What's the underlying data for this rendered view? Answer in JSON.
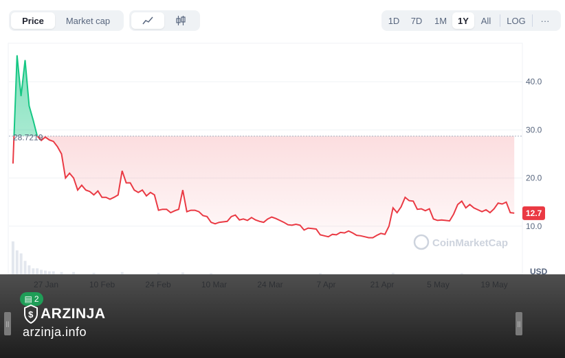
{
  "toolbar": {
    "metric_tabs": [
      {
        "label": "Price",
        "active": true
      },
      {
        "label": "Market cap",
        "active": false
      }
    ],
    "chart_type_icons": [
      {
        "icon": "line-chart-icon",
        "active": true
      },
      {
        "icon": "candlestick-icon",
        "active": false
      }
    ],
    "ranges": [
      {
        "label": "1D",
        "active": false
      },
      {
        "label": "7D",
        "active": false
      },
      {
        "label": "1M",
        "active": false
      },
      {
        "label": "1Y",
        "active": true
      },
      {
        "label": "All",
        "active": false
      }
    ],
    "log_label": "LOG",
    "more_label": "···"
  },
  "chart_data": {
    "type": "area",
    "currency_label": "USD",
    "reference_label": "28.7219",
    "reference_value": 28.7219,
    "current_label": "12.7",
    "current_value": 12.7,
    "y_ticks": [
      {
        "value": 10,
        "label": "10.0"
      },
      {
        "value": 20,
        "label": "20.0"
      },
      {
        "value": 30,
        "label": "30.0"
      },
      {
        "value": 40,
        "label": "40.0"
      }
    ],
    "x_ticks": [
      "27 Jan",
      "10 Feb",
      "24 Feb",
      "10 Mar",
      "24 Mar",
      "7 Apr",
      "21 Apr",
      "5 May",
      "19 May"
    ],
    "x_range": [
      "2025-01-20",
      "2025-05-27"
    ],
    "ylim": [
      0,
      48
    ],
    "series": [
      {
        "points": [
          [
            "2025-01-21",
            23
          ],
          [
            "2025-01-22",
            45.5
          ],
          [
            "2025-01-23",
            37
          ],
          [
            "2025-01-24",
            44.5
          ],
          [
            "2025-01-25",
            35
          ],
          [
            "2025-01-26",
            32
          ],
          [
            "2025-01-27",
            28.7
          ],
          [
            "2025-01-28",
            27.8
          ],
          [
            "2025-01-29",
            28.5
          ],
          [
            "2025-01-30",
            27.9
          ],
          [
            "2025-01-31",
            27.6
          ],
          [
            "2025-02-01",
            26.5
          ],
          [
            "2025-02-02",
            25
          ],
          [
            "2025-02-03",
            20
          ],
          [
            "2025-02-04",
            21
          ],
          [
            "2025-02-05",
            20
          ],
          [
            "2025-02-06",
            17.5
          ],
          [
            "2025-02-07",
            18.5
          ],
          [
            "2025-02-08",
            17.5
          ],
          [
            "2025-02-09",
            17.2
          ],
          [
            "2025-02-10",
            16.5
          ],
          [
            "2025-02-11",
            17.3
          ],
          [
            "2025-02-12",
            16
          ],
          [
            "2025-02-13",
            16
          ],
          [
            "2025-02-14",
            15.6
          ],
          [
            "2025-02-15",
            16
          ],
          [
            "2025-02-16",
            16.5
          ],
          [
            "2025-02-17",
            21.5
          ],
          [
            "2025-02-18",
            19
          ],
          [
            "2025-02-19",
            19
          ],
          [
            "2025-02-20",
            17.5
          ],
          [
            "2025-02-21",
            17
          ],
          [
            "2025-02-22",
            17.5
          ],
          [
            "2025-02-23",
            16.3
          ],
          [
            "2025-02-24",
            17
          ],
          [
            "2025-02-25",
            16.5
          ],
          [
            "2025-02-26",
            13.3
          ],
          [
            "2025-02-27",
            13.5
          ],
          [
            "2025-02-28",
            13.5
          ],
          [
            "2025-03-01",
            12.8
          ],
          [
            "2025-03-02",
            13.2
          ],
          [
            "2025-03-03",
            13.5
          ],
          [
            "2025-03-04",
            17.5
          ],
          [
            "2025-03-05",
            13
          ],
          [
            "2025-03-06",
            13.3
          ],
          [
            "2025-03-07",
            13.3
          ],
          [
            "2025-03-08",
            13
          ],
          [
            "2025-03-09",
            12.2
          ],
          [
            "2025-03-10",
            12
          ],
          [
            "2025-03-11",
            10.8
          ],
          [
            "2025-03-12",
            10.5
          ],
          [
            "2025-03-13",
            10.8
          ],
          [
            "2025-03-14",
            10.9
          ],
          [
            "2025-03-15",
            11
          ],
          [
            "2025-03-16",
            12
          ],
          [
            "2025-03-17",
            12.3
          ],
          [
            "2025-03-18",
            11.3
          ],
          [
            "2025-03-19",
            11.5
          ],
          [
            "2025-03-20",
            11.2
          ],
          [
            "2025-03-21",
            11.8
          ],
          [
            "2025-03-22",
            11.3
          ],
          [
            "2025-03-23",
            11
          ],
          [
            "2025-03-24",
            10.8
          ],
          [
            "2025-03-25",
            11.5
          ],
          [
            "2025-03-26",
            11.9
          ],
          [
            "2025-03-27",
            11.6
          ],
          [
            "2025-03-28",
            11.2
          ],
          [
            "2025-03-29",
            10.8
          ],
          [
            "2025-03-30",
            10.3
          ],
          [
            "2025-03-31",
            10.2
          ],
          [
            "2025-04-01",
            10.4
          ],
          [
            "2025-04-02",
            10.2
          ],
          [
            "2025-04-03",
            9.2
          ],
          [
            "2025-04-04",
            9.6
          ],
          [
            "2025-04-05",
            9.5
          ],
          [
            "2025-04-06",
            9.4
          ],
          [
            "2025-04-07",
            8.2
          ],
          [
            "2025-04-08",
            8
          ],
          [
            "2025-04-09",
            7.8
          ],
          [
            "2025-04-10",
            8.3
          ],
          [
            "2025-04-11",
            8.2
          ],
          [
            "2025-04-12",
            8.7
          ],
          [
            "2025-04-13",
            8.6
          ],
          [
            "2025-04-14",
            9
          ],
          [
            "2025-04-15",
            8.6
          ],
          [
            "2025-04-16",
            8.1
          ],
          [
            "2025-04-17",
            8
          ],
          [
            "2025-04-18",
            7.8
          ],
          [
            "2025-04-19",
            7.6
          ],
          [
            "2025-04-20",
            7.6
          ],
          [
            "2025-04-21",
            8.1
          ],
          [
            "2025-04-22",
            8.5
          ],
          [
            "2025-04-23",
            8.3
          ],
          [
            "2025-04-24",
            10
          ],
          [
            "2025-04-25",
            13.8
          ],
          [
            "2025-04-26",
            12.8
          ],
          [
            "2025-04-27",
            14
          ],
          [
            "2025-04-28",
            16
          ],
          [
            "2025-04-29",
            15.3
          ],
          [
            "2025-04-30",
            15.2
          ],
          [
            "2025-05-01",
            13.5
          ],
          [
            "2025-05-02",
            13.6
          ],
          [
            "2025-05-03",
            13.2
          ],
          [
            "2025-05-04",
            13.6
          ],
          [
            "2025-05-05",
            11.5
          ],
          [
            "2025-05-06",
            11.2
          ],
          [
            "2025-05-07",
            11.3
          ],
          [
            "2025-05-08",
            11.2
          ],
          [
            "2025-05-09",
            11.1
          ],
          [
            "2025-05-10",
            12.5
          ],
          [
            "2025-05-11",
            14.5
          ],
          [
            "2025-05-12",
            15.2
          ],
          [
            "2025-05-13",
            13.8
          ],
          [
            "2025-05-14",
            14.5
          ],
          [
            "2025-05-15",
            13.8
          ],
          [
            "2025-05-16",
            13.4
          ],
          [
            "2025-05-17",
            13
          ],
          [
            "2025-05-18",
            13.4
          ],
          [
            "2025-05-19",
            12.8
          ],
          [
            "2025-05-20",
            13.6
          ],
          [
            "2025-05-21",
            14.8
          ],
          [
            "2025-05-22",
            14.6
          ],
          [
            "2025-05-23",
            15
          ],
          [
            "2025-05-24",
            12.8
          ],
          [
            "2025-05-25",
            12.7
          ]
        ]
      }
    ],
    "volume": [
      [
        "2025-01-21",
        22
      ],
      [
        "2025-01-22",
        16
      ],
      [
        "2025-01-23",
        14
      ],
      [
        "2025-01-24",
        9
      ],
      [
        "2025-01-25",
        6
      ],
      [
        "2025-01-26",
        4
      ],
      [
        "2025-01-27",
        4
      ],
      [
        "2025-01-28",
        3
      ],
      [
        "2025-01-29",
        2.5
      ],
      [
        "2025-01-30",
        2
      ],
      [
        "2025-01-31",
        2
      ],
      [
        "2025-02-02",
        1.5
      ],
      [
        "2025-02-05",
        1.5
      ],
      [
        "2025-02-10",
        1
      ],
      [
        "2025-02-17",
        1.5
      ],
      [
        "2025-02-26",
        1
      ],
      [
        "2025-03-04",
        1.2
      ],
      [
        "2025-03-11",
        0.8
      ],
      [
        "2025-04-07",
        0.8
      ],
      [
        "2025-04-25",
        1
      ],
      [
        "2025-05-12",
        0.8
      ]
    ],
    "up_color": "#16c784",
    "down_color": "#ea3943",
    "watermark_text": "CoinMarketCap"
  },
  "watermark": {
    "brand": "ARZINJA",
    "url": "arzinja.info",
    "badge_count": "2"
  }
}
